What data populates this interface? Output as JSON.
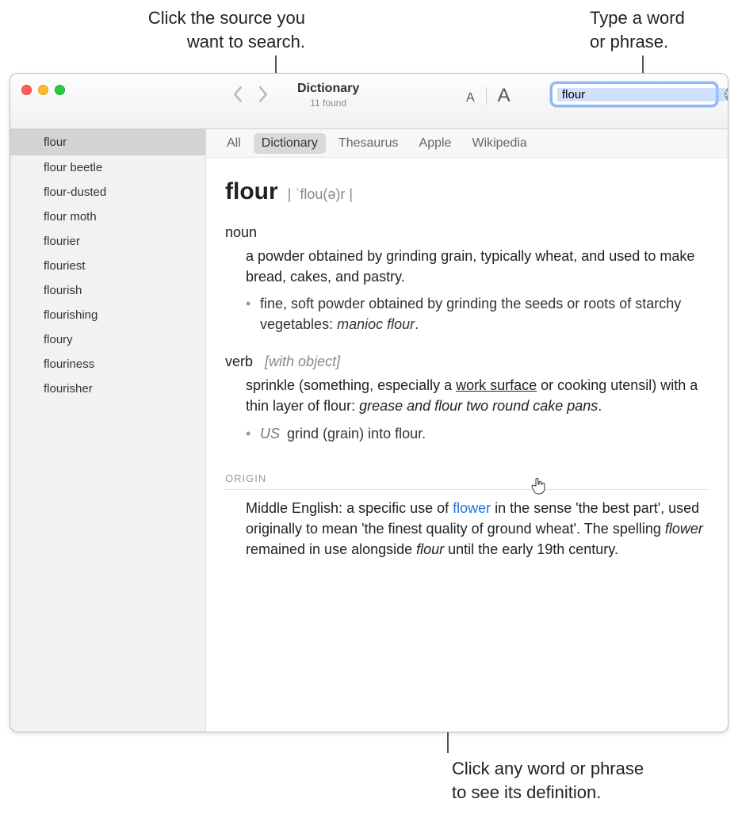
{
  "callouts": {
    "top_left": "Click the source you\nwant to search.",
    "top_right": "Type a word\nor phrase.",
    "bottom": "Click any word or phrase\nto see its definition."
  },
  "toolbar": {
    "title": "Dictionary",
    "subtitle": "11 found",
    "font_small": "A",
    "font_large": "A"
  },
  "search": {
    "value": "flour"
  },
  "tabs": [
    "All",
    "Dictionary",
    "Thesaurus",
    "Apple",
    "Wikipedia"
  ],
  "active_tab_index": 1,
  "sidebar": [
    "flour",
    "flour beetle",
    "flour-dusted",
    "flour moth",
    "flourier",
    "flouriest",
    "flourish",
    "flourishing",
    "floury",
    "flouriness",
    "flourisher"
  ],
  "sidebar_selected_index": 0,
  "entry": {
    "headword": "flour",
    "pronunciation": "| ˈflou(ə)r |",
    "noun": {
      "label": "noun",
      "def": "a powder obtained by grinding grain, typically wheat, and used to make bread, cakes, and pastry.",
      "sub_def": "fine, soft powder obtained by grinding the seeds or roots of starchy vegetables: ",
      "sub_ex": "manioc flour",
      "period": "."
    },
    "verb": {
      "label": "verb",
      "qualifier": "[with object]",
      "def_pre": "sprinkle (something, especially a ",
      "def_link": "work surface",
      "def_post": " or cooking utensil) with a thin layer of flour: ",
      "def_ex": "grease and flour two round cake pans",
      "def_period": ".",
      "sub_region": "US",
      "sub_def": " grind (grain) into flour."
    },
    "origin": {
      "heading": "ORIGIN",
      "t1": "Middle English: a specific use of ",
      "link": "flower",
      "t2": " in the sense 'the best part', used originally to mean 'the finest quality of ground wheat'. The spelling ",
      "ital1": "flower",
      "t3": " remained in use alongside ",
      "ital2": "flour",
      "t4": " until the early 19th century."
    }
  }
}
